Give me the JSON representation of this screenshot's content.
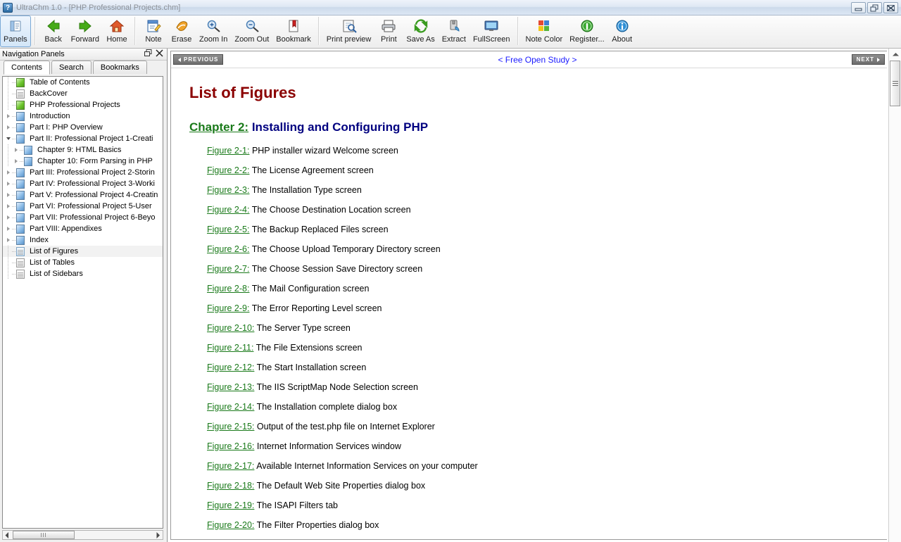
{
  "window": {
    "title": "UltraChm 1.0  - [PHP Professional Projects.chm]",
    "icon": "help-question-icon",
    "controls": {
      "minimize": "minimize-icon",
      "restore": "restore-icon",
      "close": "close-icon"
    }
  },
  "toolbar": {
    "items": [
      {
        "label": "Panels",
        "icon": "panels-icon",
        "active": true
      },
      {
        "label": "Back",
        "icon": "arrow-left-icon",
        "active": false
      },
      {
        "label": "Forward",
        "icon": "arrow-right-icon",
        "active": false
      },
      {
        "label": "Home",
        "icon": "home-icon",
        "active": false
      },
      {
        "label": "Note",
        "icon": "note-edit-icon",
        "active": false
      },
      {
        "label": "Erase",
        "icon": "eraser-icon",
        "active": false
      },
      {
        "label": "Zoom In",
        "icon": "zoom-in-icon",
        "active": false
      },
      {
        "label": "Zoom Out",
        "icon": "zoom-out-icon",
        "active": false
      },
      {
        "label": "Bookmark",
        "icon": "bookmark-icon",
        "active": false
      },
      {
        "label": "Print preview",
        "icon": "print-preview-icon",
        "active": false
      },
      {
        "label": "Print",
        "icon": "printer-icon",
        "active": false
      },
      {
        "label": "Save As",
        "icon": "save-as-icon",
        "active": false
      },
      {
        "label": "Extract",
        "icon": "extract-icon",
        "active": false
      },
      {
        "label": "FullScreen",
        "icon": "fullscreen-icon",
        "active": false
      },
      {
        "label": "Note Color",
        "icon": "note-color-icon",
        "active": false
      },
      {
        "label": "Register...",
        "icon": "register-icon",
        "active": false
      },
      {
        "label": "About",
        "icon": "info-icon",
        "active": false
      }
    ],
    "separators_after": [
      0,
      3,
      8,
      13
    ]
  },
  "sidebar": {
    "header": {
      "title": "Navigation Panels",
      "float_icon": "float-window-icon",
      "close_icon": "close-icon"
    },
    "tabs": [
      {
        "label": "Contents",
        "selected": true
      },
      {
        "label": "Search",
        "selected": false
      },
      {
        "label": "Bookmarks",
        "selected": false
      }
    ],
    "tree": [
      {
        "label": "Table of Contents",
        "indent": 0,
        "icon": "page-green-icon",
        "toggle": "none",
        "selected": false
      },
      {
        "label": "BackCover",
        "indent": 0,
        "icon": "page-white-icon",
        "toggle": "none",
        "selected": false
      },
      {
        "label": "PHP Professional Projects",
        "indent": 0,
        "icon": "page-green-icon",
        "toggle": "none",
        "selected": false
      },
      {
        "label": "Introduction",
        "indent": 0,
        "icon": "page-blue-icon",
        "toggle": "collapsed",
        "selected": false
      },
      {
        "label": "Part I:  PHP Overview",
        "indent": 0,
        "icon": "page-blue-icon",
        "toggle": "collapsed",
        "selected": false
      },
      {
        "label": "Part II:  Professional Project 1-Creati",
        "indent": 0,
        "icon": "page-blue-icon",
        "toggle": "expanded",
        "selected": false
      },
      {
        "label": "Chapter 9:  HTML Basics",
        "indent": 1,
        "icon": "page-blue-icon",
        "toggle": "collapsed",
        "selected": false
      },
      {
        "label": "Chapter 10:  Form Parsing in PHP",
        "indent": 1,
        "icon": "page-blue-icon",
        "toggle": "collapsed",
        "selected": false
      },
      {
        "label": "Part III:  Professional Project 2-Storin",
        "indent": 0,
        "icon": "page-blue-icon",
        "toggle": "collapsed",
        "selected": false
      },
      {
        "label": "Part IV:  Professional Project 3-Worki",
        "indent": 0,
        "icon": "page-blue-icon",
        "toggle": "collapsed",
        "selected": false
      },
      {
        "label": "Part V:  Professional Project 4-Creatin",
        "indent": 0,
        "icon": "page-blue-icon",
        "toggle": "collapsed",
        "selected": false
      },
      {
        "label": "Part VI:  Professional Project 5-User ",
        "indent": 0,
        "icon": "page-blue-icon",
        "toggle": "collapsed",
        "selected": false
      },
      {
        "label": "Part VII:  Professional Project 6-Beyo",
        "indent": 0,
        "icon": "page-blue-icon",
        "toggle": "collapsed",
        "selected": false
      },
      {
        "label": "Part VIII:  Appendixes",
        "indent": 0,
        "icon": "page-blue-icon",
        "toggle": "collapsed",
        "selected": false
      },
      {
        "label": "Index",
        "indent": 0,
        "icon": "page-blue-icon",
        "toggle": "collapsed",
        "selected": false
      },
      {
        "label": "List of Figures",
        "indent": 0,
        "icon": "page-bluepage-icon",
        "toggle": "none",
        "selected": true
      },
      {
        "label": "List of Tables",
        "indent": 0,
        "icon": "page-white-icon",
        "toggle": "none",
        "selected": false
      },
      {
        "label": "List of Sidebars",
        "indent": 0,
        "icon": "page-white-icon",
        "toggle": "none",
        "selected": false
      }
    ],
    "hscroll": {
      "left_arrow": "arrow-left-icon",
      "right_arrow": "arrow-right-icon",
      "grip": "grip-icon"
    }
  },
  "document": {
    "nav": {
      "previous_label": "PREVIOUS",
      "next_label": "NEXT",
      "center_label": "< Free Open Study >"
    },
    "title": "List of Figures",
    "chapter_prefix": "Chapter 2:",
    "chapter_title": "Installing and Configuring PHP",
    "figures": [
      {
        "num": "Figure 2-1:",
        "text": "PHP installer wizard Welcome screen"
      },
      {
        "num": "Figure 2-2:",
        "text": "The License Agreement screen"
      },
      {
        "num": "Figure 2-3:",
        "text": "The Installation Type screen"
      },
      {
        "num": "Figure 2-4:",
        "text": "The Choose Destination Location screen"
      },
      {
        "num": "Figure 2-5:",
        "text": "The Backup Replaced Files screen"
      },
      {
        "num": "Figure 2-6:",
        "text": "The Choose Upload Temporary Directory screen"
      },
      {
        "num": "Figure 2-7:",
        "text": "The Choose Session Save Directory screen"
      },
      {
        "num": "Figure 2-8:",
        "text": "The Mail Configuration screen"
      },
      {
        "num": "Figure 2-9:",
        "text": "The Error Reporting Level screen"
      },
      {
        "num": "Figure 2-10:",
        "text": "The Server Type screen"
      },
      {
        "num": "Figure 2-11:",
        "text": "The File Extensions screen"
      },
      {
        "num": "Figure 2-12:",
        "text": "The Start Installation screen"
      },
      {
        "num": "Figure 2-13:",
        "text": "The IIS ScriptMap Node Selection screen"
      },
      {
        "num": "Figure 2-14:",
        "text": "The Installation complete dialog box"
      },
      {
        "num": "Figure 2-15:",
        "text": "Output of the test.php file on Internet Explorer"
      },
      {
        "num": "Figure 2-16:",
        "text": "Internet Information Services window"
      },
      {
        "num": "Figure 2-17:",
        "text": "Available Internet Information Services on your computer"
      },
      {
        "num": "Figure 2-18:",
        "text": "The Default Web Site Properties dialog box"
      },
      {
        "num": "Figure 2-19:",
        "text": "The ISAPI Filters tab"
      },
      {
        "num": "Figure 2-20:",
        "text": "The Filter Properties dialog box"
      }
    ]
  },
  "colors": {
    "title_red": "#8b0000",
    "link_green": "#1a7a1a",
    "heading_navy": "#000080",
    "nav_link_blue": "#1a1aff"
  }
}
